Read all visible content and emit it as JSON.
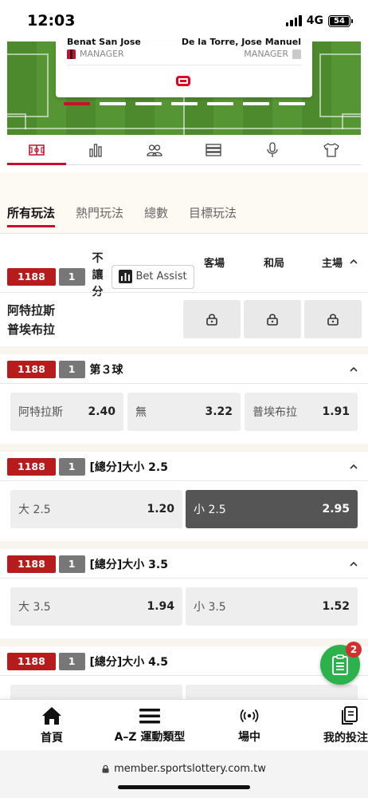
{
  "status": {
    "time": "12:03",
    "network": "4G",
    "battery": "54"
  },
  "lineup": {
    "home_manager_name": "Benat San Jose",
    "away_manager_name": "De la Torre, Jose Manuel",
    "home_role": "MANAGER",
    "away_role": "MANAGER"
  },
  "colors": {
    "accent": "#c8102e",
    "code_bg": "#b71c1c",
    "fab": "#2bb24c",
    "selected_odd": "#555555"
  },
  "icon_tabs": [
    "pitch-icon",
    "stats-bars-icon",
    "players-icon",
    "list-icon",
    "microphone-icon",
    "shirt-icon"
  ],
  "bet_tabs": [
    "所有玩法",
    "熱門玩法",
    "總數",
    "目標玩法"
  ],
  "market1": {
    "code": "1188",
    "num": "1",
    "title": "不讓分",
    "bet_assist": "Bet Assist",
    "col_away": "客場",
    "col_draw": "和局",
    "col_home": "主場",
    "team1": "阿特拉斯",
    "team2": "普埃布拉"
  },
  "market2": {
    "code": "1188",
    "num": "1",
    "title": "第３球",
    "opt1_label": "阿特拉斯",
    "opt1_val": "2.40",
    "opt2_label": "無",
    "opt2_val": "3.22",
    "opt3_label": "普埃布拉",
    "opt3_val": "1.91"
  },
  "market3": {
    "code": "1188",
    "num": "1",
    "title": "[總分]大小 2.5",
    "over_label": "大 2.5",
    "over_val": "1.20",
    "under_label": "小 2.5",
    "under_val": "2.95"
  },
  "market4": {
    "code": "1188",
    "num": "1",
    "title": "[總分]大小 3.5",
    "over_label": "大 3.5",
    "over_val": "1.94",
    "under_label": "小 3.5",
    "under_val": "1.52"
  },
  "market5": {
    "code": "1188",
    "num": "1",
    "title": "[總分]大小 4.5"
  },
  "betslip_count": "2",
  "bottom_nav": {
    "home": "首頁",
    "sports": "A–Z 運動類型",
    "live": "場中",
    "mybets": "我的投注"
  },
  "url": "member.sportslottery.com.tw"
}
